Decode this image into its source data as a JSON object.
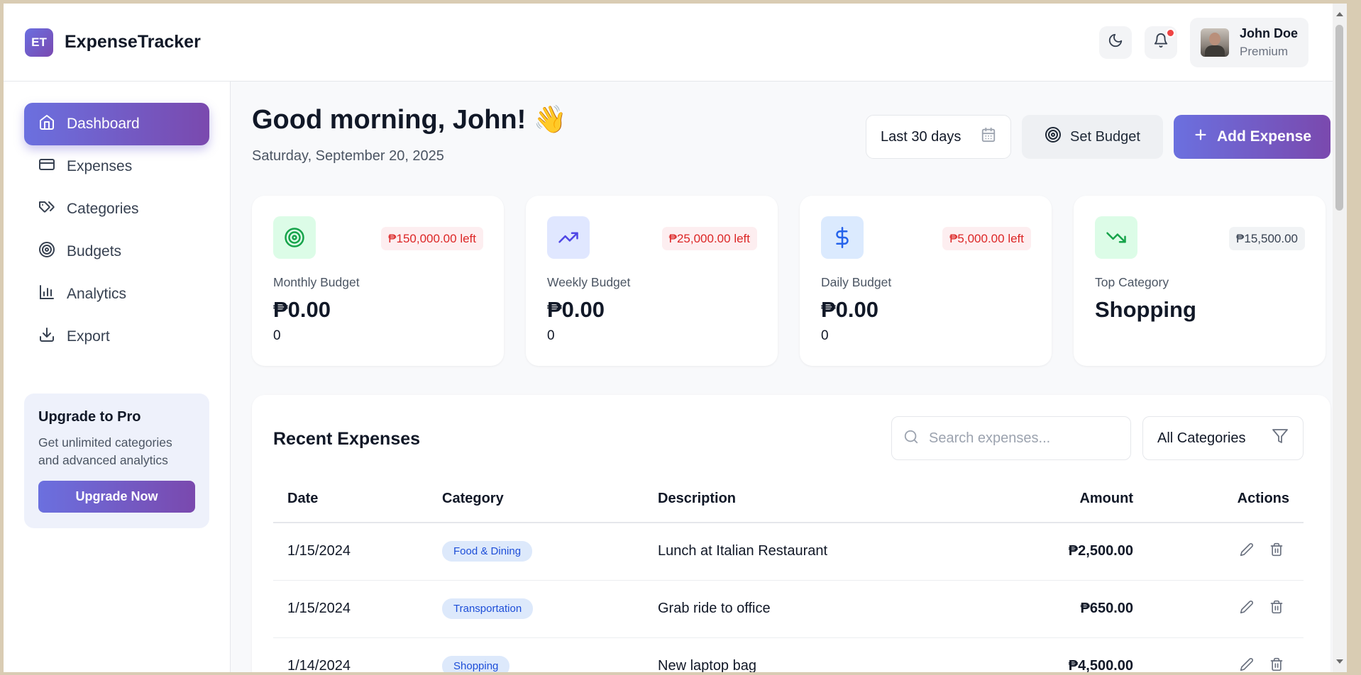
{
  "app": {
    "logo_mark": "ET",
    "name": "ExpenseTracker"
  },
  "header": {
    "theme_icon": "moon-icon",
    "notification_icon": "bell-icon",
    "user": {
      "name": "John Doe",
      "tier": "Premium"
    }
  },
  "sidebar": {
    "items": [
      {
        "label": "Dashboard",
        "icon": "home-icon",
        "active": true
      },
      {
        "label": "Expenses",
        "icon": "credit-card-icon"
      },
      {
        "label": "Categories",
        "icon": "tags-icon"
      },
      {
        "label": "Budgets",
        "icon": "target-icon"
      },
      {
        "label": "Analytics",
        "icon": "bar-chart-icon"
      },
      {
        "label": "Export",
        "icon": "download-icon"
      }
    ],
    "upgrade": {
      "title": "Upgrade to Pro",
      "description": "Get unlimited categories and advanced analytics",
      "button": "Upgrade Now"
    }
  },
  "main": {
    "greeting": "Good morning, John! 👋",
    "date": "Saturday, September 20, 2025",
    "range_label": "Last 30 days",
    "set_budget_label": "Set Budget",
    "add_expense_label": "Add Expense"
  },
  "cards": [
    {
      "label": "Monthly Budget",
      "value": "₱0.00",
      "sub": "0",
      "badge": "₱150,000.00 left",
      "icon": "target-icon",
      "icon_color": "#16a34a",
      "icon_bg": "#dcfce7"
    },
    {
      "label": "Weekly Budget",
      "value": "₱0.00",
      "sub": "0",
      "badge": "₱25,000.00 left",
      "icon": "trending-up-icon",
      "icon_color": "#4f46e5",
      "icon_bg": "#e0e7ff"
    },
    {
      "label": "Daily Budget",
      "value": "₱0.00",
      "sub": "0",
      "badge": "₱5,000.00 left",
      "icon": "dollar-icon",
      "icon_color": "#2563eb",
      "icon_bg": "#dbeafe"
    },
    {
      "label": "Top Category",
      "value": "Shopping",
      "sub": "",
      "badge": "₱15,500.00",
      "icon": "trending-down-icon",
      "icon_color": "#16a34a",
      "icon_bg": "#dcfce7"
    }
  ],
  "expenses": {
    "title": "Recent Expenses",
    "search_placeholder": "Search expenses...",
    "filter_label": "All Categories",
    "columns": [
      "Date",
      "Category",
      "Description",
      "Amount",
      "Actions"
    ],
    "rows": [
      {
        "date": "1/15/2024",
        "category": "Food & Dining",
        "description": "Lunch at Italian Restaurant",
        "amount": "₱2,500.00"
      },
      {
        "date": "1/15/2024",
        "category": "Transportation",
        "description": "Grab ride to office",
        "amount": "₱650.00"
      },
      {
        "date": "1/14/2024",
        "category": "Shopping",
        "description": "New laptop bag",
        "amount": "₱4,500.00"
      }
    ]
  },
  "colors": {
    "accent_start": "#6b70df",
    "accent_end": "#7a49ae",
    "danger": "#dc2626"
  }
}
